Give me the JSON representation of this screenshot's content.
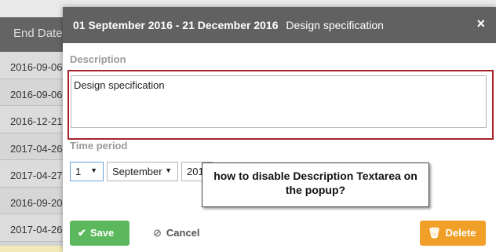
{
  "background": {
    "column_header": "End Date",
    "end_dates": [
      "2016-09-06",
      "2016-09-06",
      "2016-12-21",
      "2017-04-26",
      "2017-04-27",
      "2016-09-20",
      "2017-04-26"
    ]
  },
  "modal": {
    "title_dates": "01 September 2016 - 21 December 2016",
    "title_subtitle": "Design specification",
    "close_glyph": "×",
    "description_label": "Description",
    "description_value": "Design specification",
    "time_period_label": "Time period",
    "day_value": "1",
    "month_value": "September",
    "year_value": "201",
    "annotation": "how to disable Description Textarea on the popup?",
    "save_label": "Save",
    "cancel_label": "Cancel",
    "delete_label": "Delete"
  },
  "icons": {
    "save": "check-icon",
    "cancel": "ban-icon",
    "delete": "trash-icon",
    "close": "close-icon",
    "select_arrow": "caret-down-icon"
  },
  "colors": {
    "highlight_border": "#a8232a",
    "save_button": "#5cb85c",
    "delete_button": "#f0a028",
    "modal_header": "#616161"
  }
}
